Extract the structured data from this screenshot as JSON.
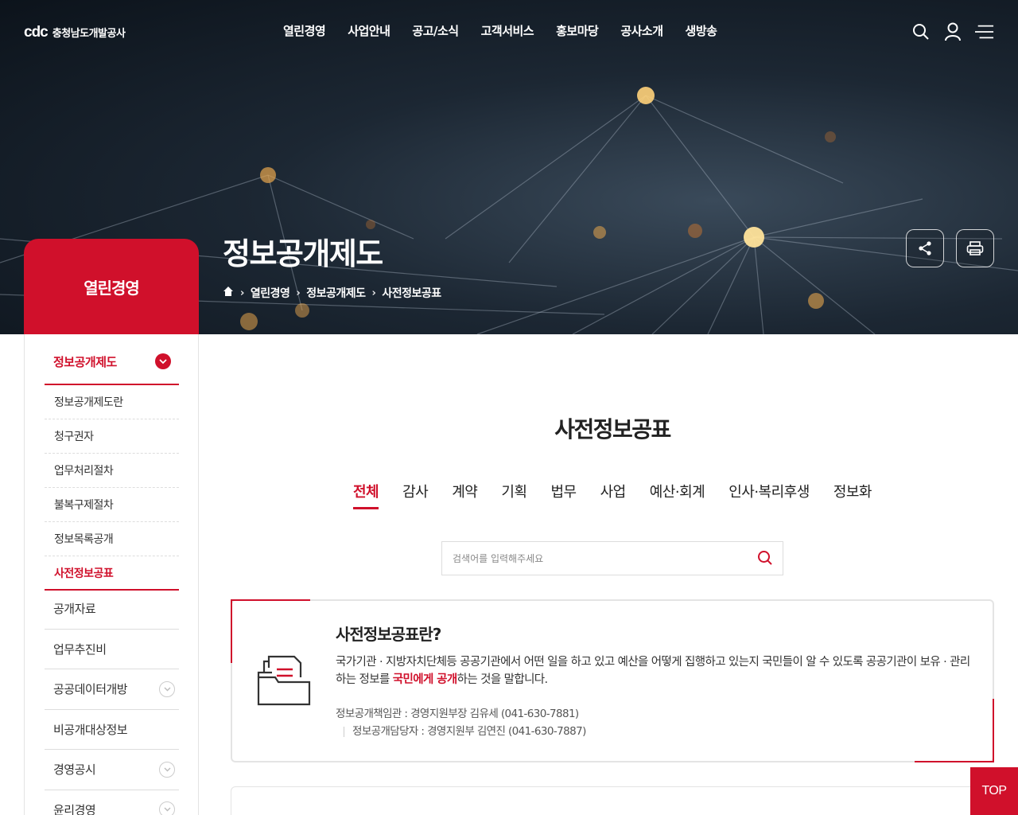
{
  "header": {
    "logo_mark": "cdc",
    "logo_name": "충청남도개발공사",
    "nav": [
      "열린경영",
      "사업안내",
      "공고/소식",
      "고객서비스",
      "홍보마당",
      "공사소개",
      "생방송"
    ]
  },
  "hero": {
    "title": "정보공개제도",
    "breadcrumb": [
      "열린경영",
      "정보공개제도",
      "사전정보공표"
    ]
  },
  "sidebar": {
    "title": "열린경영",
    "group_label": "정보공개제도",
    "sub_items": [
      "정보공개제도란",
      "청구권자",
      "업무처리절차",
      "불복구제절차",
      "정보목록공개",
      "사전정보공표"
    ],
    "items": [
      "공개자료",
      "업무추진비",
      "공공데이터개방",
      "비공개대상정보",
      "경영공시",
      "윤리경영"
    ]
  },
  "main": {
    "heading": "사전정보공표",
    "tabs": [
      "전체",
      "감사",
      "계약",
      "기획",
      "법무",
      "사업",
      "예산·회계",
      "인사·복리후생",
      "정보화"
    ],
    "search_placeholder": "검색어를 입력해주세요",
    "info": {
      "title": "사전정보공표란?",
      "desc_before": "국가기관 · 지방자치단체등 공공기관에서 어떤 일을 하고 있고 예산을 어떻게 집행하고 있는지 국민들이 알 수 있도록 공공기관이 보유 · 관리하는 정보를 ",
      "desc_highlight": "국민에게 공개",
      "desc_after": "하는 것을 말합니다.",
      "contact1": "정보공개책임관 : 경영지원부장 김유세 (041-630-7881)",
      "contact2": "정보공개담당자 : 경영지원부 김연진 (041-630-7887)"
    }
  },
  "top_button": "TOP",
  "colors": {
    "accent": "#d0102b"
  },
  "icons": [
    "search-icon",
    "user-icon",
    "menu-icon",
    "home-icon",
    "share-icon",
    "print-icon",
    "chevron-down-icon",
    "folder-document-icon"
  ]
}
